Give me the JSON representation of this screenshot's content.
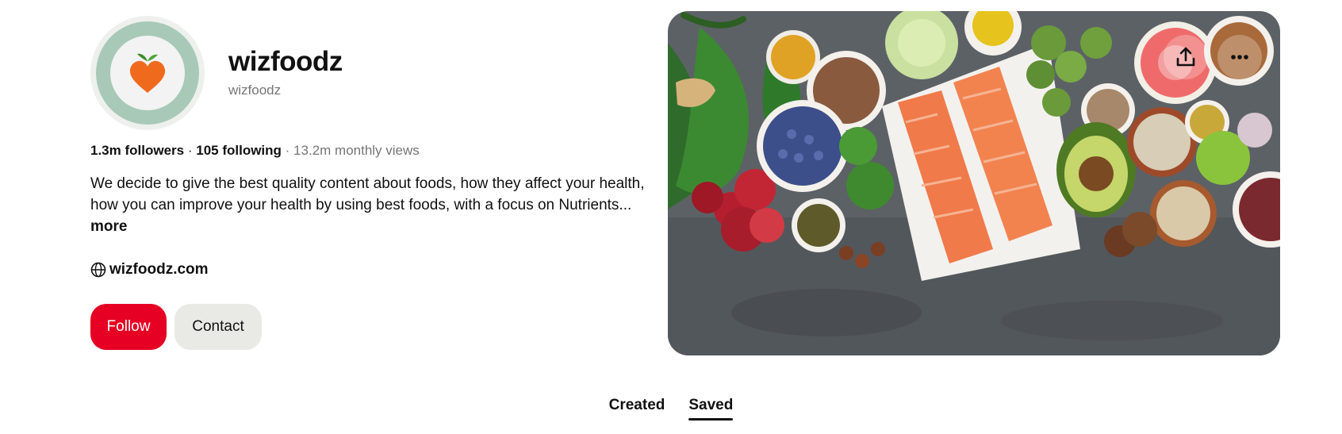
{
  "profile": {
    "name": "wizfoodz",
    "handle": "wizfoodz",
    "followers": "1.3m followers",
    "stats_separator": "·",
    "following": "105 following",
    "monthly_views": "· 13.2m monthly views",
    "bio": "We decide to give the best quality content about foods, how they affect your health, how you can improve your health by using best foods, with a focus on Nutrients...",
    "bio_more": "more",
    "website": "wizfoodz.com",
    "website_icon": "globe-icon",
    "avatar_icon": "heart-fruit-icon"
  },
  "actions": {
    "follow_label": "Follow",
    "contact_label": "Contact"
  },
  "cover": {
    "share_icon": "share-upload-icon",
    "more_icon": "more-options-icon"
  },
  "tabs": [
    {
      "label": "Created",
      "active": false
    },
    {
      "label": "Saved",
      "active": true
    }
  ],
  "colors": {
    "follow_red": "#e60023",
    "contact_gray": "#e9e9e5",
    "avatar_green": "#a8c9b8",
    "muted_text": "#767676"
  }
}
